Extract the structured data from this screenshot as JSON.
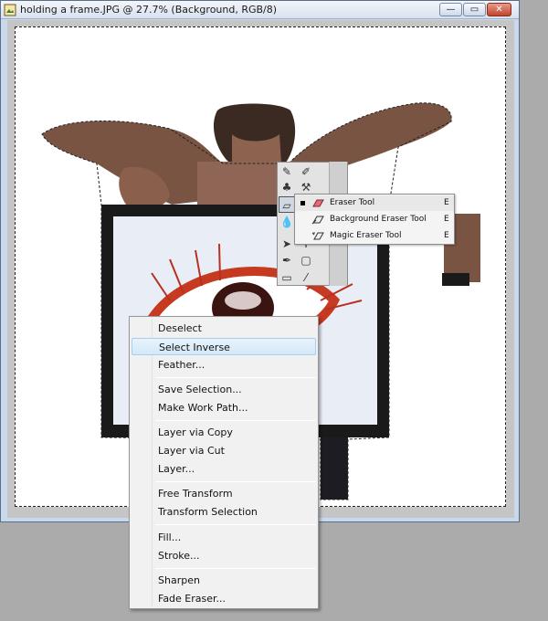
{
  "window": {
    "title": "holding a frame.JPG @ 27.7% (Background, RGB/8)",
    "min_label": "—",
    "max_label": "▭",
    "close_label": "✕"
  },
  "tool_flyout": {
    "items": [
      {
        "label": "Eraser Tool",
        "shortcut": "E",
        "icon": "eraser-icon",
        "active": true
      },
      {
        "label": "Background Eraser Tool",
        "shortcut": "E",
        "icon": "background-eraser-icon",
        "active": false
      },
      {
        "label": "Magic Eraser Tool",
        "shortcut": "E",
        "icon": "magic-eraser-icon",
        "active": false
      }
    ]
  },
  "context_menu": {
    "items": [
      "Deselect",
      "Select Inverse",
      "Feather...",
      "Save Selection...",
      "Make Work Path...",
      "Layer via Copy",
      "Layer via Cut",
      "Layer...",
      "Free Transform",
      "Transform Selection",
      "Fill...",
      "Stroke...",
      "Sharpen",
      "Fade Eraser..."
    ],
    "highlighted": "Select Inverse"
  },
  "colors": {
    "window_frame": "#c9d8ea",
    "workspace": "#ababab",
    "menu_highlight": "#d3e8f8",
    "eraser_pink": "#e86a7a"
  }
}
